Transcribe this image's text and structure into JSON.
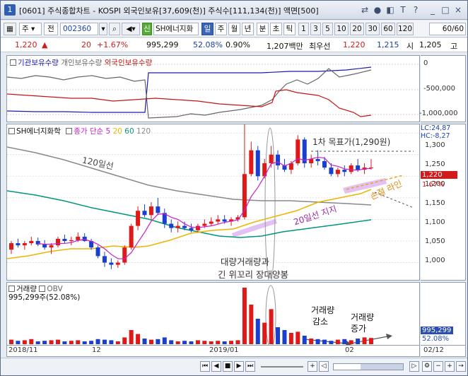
{
  "window": {
    "number": "1",
    "title": "[0601] 주식종합차트 - KOSPI 외국인보유[37,609(천)] 주식수[111,134(천)] 액면[500]",
    "controls": [
      "⇄",
      "●",
      "◧",
      "T",
      "?",
      "_",
      "□",
      "×"
    ]
  },
  "toolbar": {
    "market": "주",
    "type": "전",
    "code": "002360",
    "sin_label": "신",
    "stock_name": "SH에너지화",
    "periods": [
      "일",
      "주",
      "월",
      "년",
      "분",
      "초",
      "틱"
    ],
    "selected_period": "일",
    "intervals": [
      "1",
      "3",
      "5",
      "10",
      "20",
      "30",
      "60",
      "120"
    ],
    "count": "60/60"
  },
  "quote": {
    "price": "1,220",
    "change": "20",
    "change_pct": "+1.67%",
    "volume": "995,299",
    "volume_ratio": "52.08%",
    "turnover_rate": "0.90%",
    "amount": "1,207백만",
    "priority_label": "최우선",
    "ask": "1,220",
    "bid": "1,215",
    "open_label": "시",
    "open": "1,205",
    "high_label": "고"
  },
  "investor_panel": {
    "legend": [
      "기관보유수량",
      "개인보유수량",
      "외국인보유수량"
    ],
    "colors": [
      "#1a1ab0",
      "#666666",
      "#c81414"
    ],
    "axis_labels": [
      "0",
      "-500,000",
      "-1,000,000"
    ]
  },
  "price_panel": {
    "stock_label": "SH에너지화학",
    "ma_label": "종가 단순",
    "ma_periods": [
      "5",
      "20",
      "60",
      "120"
    ],
    "ma_colors": [
      "#c81ec8",
      "#f0b400",
      "#00967d",
      "#888888"
    ],
    "lc": "LC:24,87",
    "hc": "HC:-8,27",
    "axis_labels": [
      "1,300",
      "1,250",
      "1,200",
      "1,150",
      "1,100",
      "1,050",
      "1,000"
    ],
    "price_tag": "1,220",
    "pct_tag": "1.67%",
    "annotations": {
      "target": "1차 목표가(1,290원)",
      "ma120": "120일선",
      "stoploss": "손절 라인",
      "support": "20일선 지지",
      "bigvol_line1": "대량거래량과",
      "bigvol_line2": "긴 위꼬리 장대양봉"
    }
  },
  "volume_panel": {
    "legend": [
      "거래량",
      "OBV"
    ],
    "current": "995,299주(52.08%)",
    "axis_tag": "995,299",
    "axis_pct": "52.08%",
    "annotations": {
      "decrease_line1": "거래량",
      "decrease_line2": "감소",
      "increase_line1": "거래량",
      "increase_line2": "증가"
    }
  },
  "x_axis": {
    "labels": [
      "2018/11",
      "12",
      "2019/01",
      "02"
    ],
    "right_label": "02/12"
  },
  "chart_data": {
    "type": "candlestick",
    "ylim": [
      960,
      1320
    ],
    "candles": [
      [
        1030,
        1050,
        1020,
        1045
      ],
      [
        1045,
        1055,
        1035,
        1040
      ],
      [
        1040,
        1050,
        1030,
        1045
      ],
      [
        1045,
        1060,
        1040,
        1050
      ],
      [
        1050,
        1058,
        1038,
        1042
      ],
      [
        1042,
        1052,
        1030,
        1035
      ],
      [
        1035,
        1045,
        1020,
        1040
      ],
      [
        1040,
        1060,
        1035,
        1055
      ],
      [
        1055,
        1065,
        1045,
        1050
      ],
      [
        1050,
        1060,
        1040,
        1052
      ],
      [
        1052,
        1070,
        1048,
        1060
      ],
      [
        1060,
        1068,
        1048,
        1050
      ],
      [
        1050,
        1055,
        1030,
        1035
      ],
      [
        1035,
        1040,
        1010,
        1015
      ],
      [
        1015,
        1025,
        990,
        1000
      ],
      [
        1000,
        1010,
        985,
        995
      ],
      [
        995,
        1005,
        988,
        1000
      ],
      [
        1000,
        1040,
        995,
        1035
      ],
      [
        1035,
        1090,
        1030,
        1085
      ],
      [
        1085,
        1130,
        1075,
        1120
      ],
      [
        1120,
        1135,
        1105,
        1110
      ],
      [
        1110,
        1140,
        1100,
        1130
      ],
      [
        1130,
        1150,
        1110,
        1115
      ],
      [
        1115,
        1125,
        1080,
        1090
      ],
      [
        1090,
        1100,
        1070,
        1080
      ],
      [
        1080,
        1095,
        1070,
        1085
      ],
      [
        1085,
        1095,
        1075,
        1080
      ],
      [
        1080,
        1090,
        1070,
        1075
      ],
      [
        1075,
        1090,
        1070,
        1085
      ],
      [
        1085,
        1100,
        1080,
        1090
      ],
      [
        1090,
        1105,
        1085,
        1095
      ],
      [
        1095,
        1110,
        1090,
        1100
      ],
      [
        1100,
        1110,
        1090,
        1095
      ],
      [
        1095,
        1105,
        1085,
        1100
      ],
      [
        1100,
        1110,
        1095,
        1105
      ],
      [
        1105,
        1320,
        1100,
        1205
      ],
      [
        1205,
        1280,
        1200,
        1260
      ],
      [
        1260,
        1270,
        1190,
        1200
      ],
      [
        1200,
        1240,
        1195,
        1230
      ],
      [
        1230,
        1270,
        1220,
        1250
      ],
      [
        1250,
        1260,
        1215,
        1225
      ],
      [
        1225,
        1240,
        1210,
        1215
      ],
      [
        1215,
        1235,
        1205,
        1230
      ],
      [
        1230,
        1295,
        1225,
        1285
      ],
      [
        1285,
        1290,
        1220,
        1230
      ],
      [
        1230,
        1250,
        1220,
        1240
      ],
      [
        1240,
        1260,
        1225,
        1235
      ],
      [
        1235,
        1245,
        1215,
        1220
      ],
      [
        1220,
        1230,
        1200,
        1205
      ],
      [
        1205,
        1220,
        1198,
        1215
      ],
      [
        1215,
        1225,
        1200,
        1210
      ],
      [
        1210,
        1230,
        1205,
        1225
      ],
      [
        1225,
        1240,
        1210,
        1215
      ],
      [
        1215,
        1230,
        1205,
        1220
      ],
      [
        1220,
        1240,
        1215,
        1220
      ]
    ],
    "volume": [
      8,
      6,
      7,
      9,
      5,
      6,
      7,
      8,
      5,
      6,
      7,
      5,
      6,
      9,
      8,
      7,
      5,
      12,
      25,
      18,
      10,
      8,
      9,
      12,
      7,
      5,
      6,
      5,
      7,
      6,
      5,
      6,
      5,
      6,
      7,
      100,
      70,
      45,
      38,
      62,
      30,
      25,
      20,
      22,
      15,
      10,
      9,
      8,
      6,
      8,
      9,
      7,
      10,
      12,
      11
    ]
  }
}
